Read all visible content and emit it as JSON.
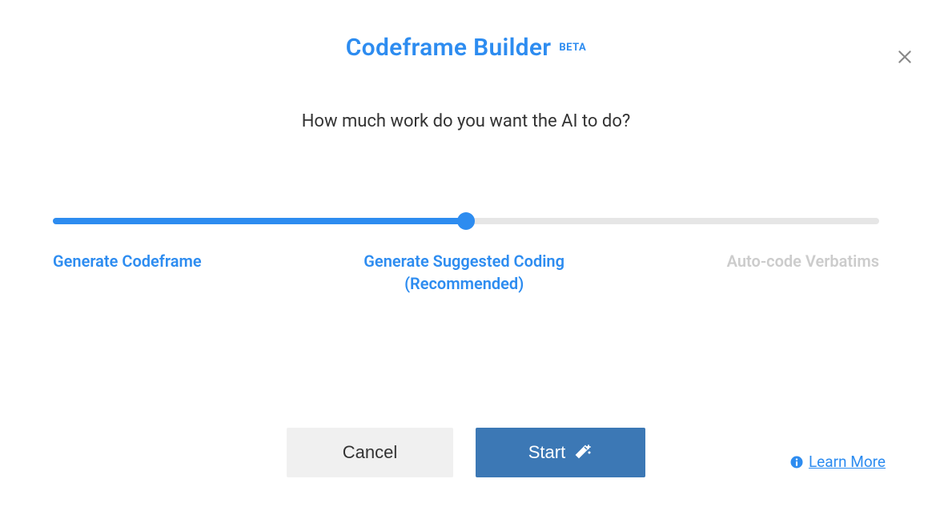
{
  "modal": {
    "title": "Codeframe Builder",
    "badge": "BETA",
    "subtitle": "How much work do you want the AI to do?"
  },
  "slider": {
    "options": [
      {
        "label": "Generate Codeframe",
        "sublabel": ""
      },
      {
        "label": "Generate Suggested Coding",
        "sublabel": "(Recommended)"
      },
      {
        "label": "Auto-code Verbatims",
        "sublabel": ""
      }
    ],
    "selected_index": 1
  },
  "buttons": {
    "cancel": "Cancel",
    "start": "Start"
  },
  "footer": {
    "learn_more": "Learn More"
  }
}
